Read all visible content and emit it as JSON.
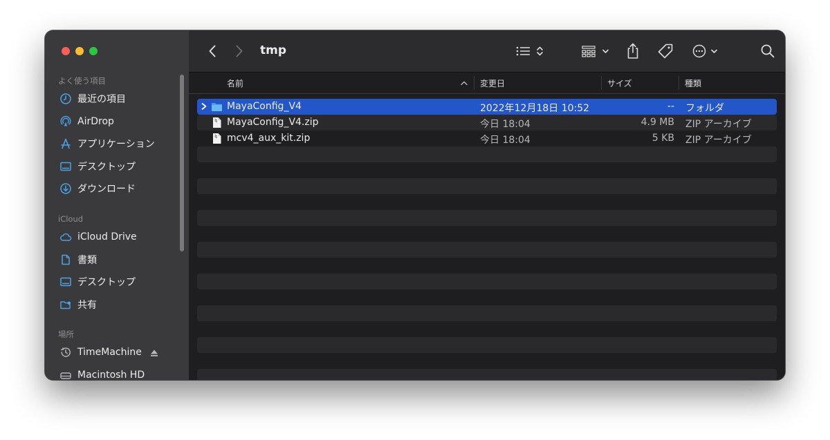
{
  "window": {
    "title": "tmp",
    "traffic_lights": {
      "close": "#ff5f57",
      "minimize": "#febc2e",
      "zoom": "#28c840"
    }
  },
  "sidebar": {
    "sections": [
      {
        "title": "よく使う項目",
        "items": [
          {
            "label": "最近の項目",
            "icon": "clock-icon"
          },
          {
            "label": "AirDrop",
            "icon": "airdrop-icon"
          },
          {
            "label": "アプリケーション",
            "icon": "applications-icon"
          },
          {
            "label": "デスクトップ",
            "icon": "desktop-icon"
          },
          {
            "label": "ダウンロード",
            "icon": "download-icon"
          }
        ]
      },
      {
        "title": "iCloud",
        "items": [
          {
            "label": "iCloud Drive",
            "icon": "cloud-icon"
          },
          {
            "label": "書類",
            "icon": "document-icon"
          },
          {
            "label": "デスクトップ",
            "icon": "desktop-icon"
          },
          {
            "label": "共有",
            "icon": "shared-folder-icon"
          }
        ]
      },
      {
        "title": "場所",
        "items": [
          {
            "label": "TimeMachine",
            "icon": "time-machine-icon"
          },
          {
            "label": "Macintosh HD",
            "icon": "disk-icon"
          }
        ]
      }
    ]
  },
  "toolbar": {
    "back_icon": "chevron-left-icon",
    "forward_icon": "chevron-right-icon",
    "view_icon": "list-view-icon",
    "group_icon": "grid-group-icon",
    "share_icon": "share-icon",
    "tag_icon": "tag-icon",
    "more_icon": "ellipsis-circle-icon",
    "search_icon": "search-icon"
  },
  "columns": {
    "name": "名前",
    "date": "変更日",
    "size": "サイズ",
    "kind": "種類"
  },
  "files": [
    {
      "name": "MayaConfig_V4",
      "date": "2022年12月18日 10:52",
      "size": "--",
      "kind": "フォルダ",
      "type": "folder",
      "selected": true
    },
    {
      "name": "MayaConfig_V4.zip",
      "date": "今日 18:04",
      "size": "4.9 MB",
      "kind": "ZIP アーカイブ",
      "type": "file",
      "selected": false
    },
    {
      "name": "mcv4_aux_kit.zip",
      "date": "今日 18:04",
      "size": "5 KB",
      "kind": "ZIP アーカイブ",
      "type": "file",
      "selected": false
    }
  ],
  "colors": {
    "selection": "#2356c9",
    "folder": "#4aa3e8",
    "sidebar_icon": "#4aa3e8"
  }
}
